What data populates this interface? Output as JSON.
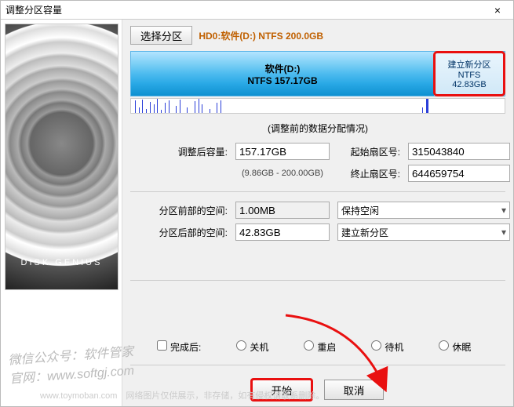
{
  "window": {
    "title": "调整分区容量",
    "close_glyph": "×"
  },
  "toolbar": {
    "select_partition": "选择分区",
    "disk_path": "HD0:软件(D:) NTFS 200.0GB"
  },
  "partition_bar": {
    "main": {
      "line1": "软件(D:)",
      "line2": "NTFS 157.17GB"
    },
    "new": {
      "line1": "建立新分区",
      "line2": "NTFS",
      "line3": "42.83GB"
    }
  },
  "section_label": "(调整前的数据分配情况)",
  "labels": {
    "adjusted_capacity": "调整后容量:",
    "start_sector": "起始扇区号:",
    "end_sector": "终止扇区号:",
    "space_before": "分区前部的空间:",
    "space_after": "分区后部的空间:",
    "after_finish": "完成后:",
    "range": "(9.86GB - 200.00GB)"
  },
  "values": {
    "adjusted_capacity": "157.17GB",
    "start_sector": "315043840",
    "end_sector": "644659754",
    "space_before": "1.00MB",
    "space_after": "42.83GB"
  },
  "options": {
    "before_action": "保持空闲",
    "after_action": "建立新分区"
  },
  "radios": {
    "shutdown": "关机",
    "restart": "重启",
    "standby": "待机",
    "hibernate": "休眠"
  },
  "buttons": {
    "start": "开始",
    "cancel": "取消"
  },
  "watermarks": {
    "line1": "微信公众号：软件管家",
    "line2": "官网：www.softgj.com",
    "footer": "www.toymoban.com　网络图片仅供展示，非存储，如有侵权请联系删除。"
  }
}
